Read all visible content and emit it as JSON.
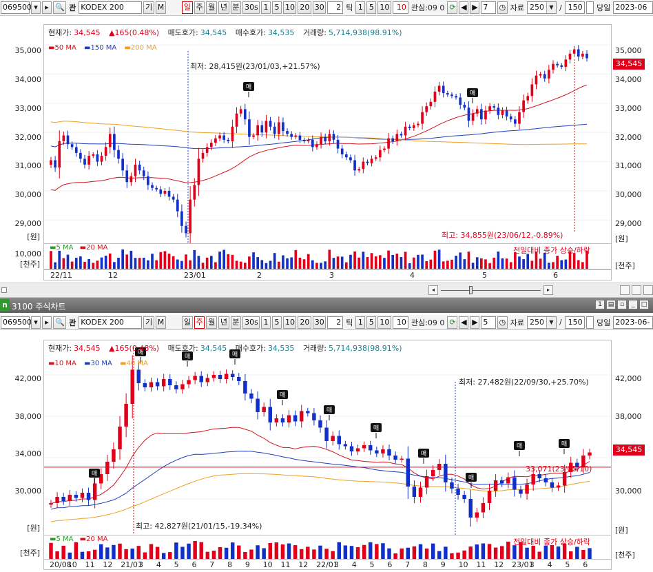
{
  "windows": [
    {
      "toolbar": {
        "code": "069500",
        "marker": "관",
        "name": "KODEX 200",
        "btn1": "기",
        "btn2": "M",
        "periods": [
          "일",
          "주",
          "월",
          "년",
          "분",
          "30s"
        ],
        "active_period": "일",
        "ticks": [
          "1",
          "5",
          "10",
          "20",
          "30"
        ],
        "tick_input": "2",
        "tick_label": "틱",
        "ticks2": [
          "1",
          "5",
          "10"
        ],
        "tick2_active": "10",
        "interest": "관심:09 0",
        "n_value": "7",
        "data_label": "자료",
        "data_count": "250",
        "slash": "/",
        "total": "150",
        "today_label": "당일",
        "date": "2023-06"
      },
      "info": {
        "cur_label": "현재가:",
        "cur": "34,545",
        "chg": "▲165(0.48%)",
        "ask_label": "매도호가:",
        "ask": "34,545",
        "bid_label": "매수호가:",
        "bid": "34,535",
        "vol_label": "거래량:",
        "vol": "5,714,938(98.91%)"
      },
      "legend": [
        {
          "label": "50 MA",
          "color": "#d4141e"
        },
        {
          "label": "150 MA",
          "color": "#1f3fbf"
        },
        {
          "label": "200 MA",
          "color": "#f0a020"
        }
      ],
      "y_ticks": [
        "35,000",
        "34,000",
        "33,000",
        "32,000",
        "31,000",
        "30,000",
        "29,000"
      ],
      "unit": "[원]",
      "last_price": "34,545",
      "low_note": "최저: 28,415원(23/01/03,+21.57%)",
      "high_note": "최고: 34,855원(23/06/12,-0.89%)",
      "sell_marks": [
        "매",
        "매"
      ],
      "vol_legend": [
        {
          "label": "5 MA",
          "color": "#2a9c2a"
        },
        {
          "label": "20 MA",
          "color": "#d4141e"
        }
      ],
      "vol_tick": "10,000",
      "vol_unit": "[천주]",
      "vol_note": "전일대비 종가 상승/하락",
      "x_labels": [
        "22/11",
        "12",
        "23/01",
        "2",
        "3",
        "4",
        "5",
        "6"
      ]
    },
    {
      "title": "3100 주식차트",
      "title_prefix": "n",
      "toolbar": {
        "code": "069500",
        "marker": "관",
        "name": "KODEX 200",
        "btn1": "기",
        "btn2": "M",
        "periods": [
          "일",
          "주",
          "월",
          "년",
          "분",
          "30s"
        ],
        "active_period": "주",
        "ticks": [
          "1",
          "5",
          "10",
          "20",
          "30"
        ],
        "tick_input": "2",
        "tick_label": "틱",
        "ticks2": [
          "1",
          "5",
          "10"
        ],
        "tick2_active": "10",
        "interest": "관심:09 0",
        "n_value": "5",
        "data_label": "자료",
        "data_count": "250",
        "slash": "/",
        "total": "150",
        "today_label": "당일",
        "date": "2023-06-"
      },
      "info": {
        "cur_label": "현재가:",
        "cur": "34,545",
        "chg": "▲165(0.48%)",
        "ask_label": "매도호가:",
        "ask": "34,545",
        "bid_label": "매수호가:",
        "bid": "34,535",
        "vol_label": "거래량:",
        "vol": "5,714,938(98.91%)"
      },
      "legend": [
        {
          "label": "10 MA",
          "color": "#d4141e"
        },
        {
          "label": "30 MA",
          "color": "#1f3fbf"
        },
        {
          "label": "40 MA",
          "color": "#f0a020"
        }
      ],
      "y_ticks": [
        "42,000",
        "38,000",
        "34,000",
        "30,000"
      ],
      "unit": "[원]",
      "last_price": "34,545",
      "low_note": "최저: 27,482원(22/09/30,+25.70%)",
      "high_note": "최고: 42,827원(21/01/15,-19.34%)",
      "hline_note": "33,071(23/05/10)",
      "sell_marks": [
        "매",
        "매",
        "매",
        "매",
        "매",
        "매",
        "매",
        "매",
        "매",
        "매",
        "매"
      ],
      "vol_legend": [
        {
          "label": "5 MA",
          "color": "#2a9c2a"
        },
        {
          "label": "20 MA",
          "color": "#d4141e"
        }
      ],
      "vol_unit": "[천주]",
      "vol_note": "전일대비 종가 상승/하락",
      "x_labels": [
        "20/08",
        "10",
        "11",
        "12",
        "21/01",
        "3",
        "4",
        "5",
        "6",
        "7",
        "8",
        "9",
        "10",
        "11",
        "12",
        "22/01",
        "3",
        "4",
        "5",
        "6",
        "7",
        "8",
        "9",
        "10",
        "11",
        "12",
        "23/01",
        "3",
        "4",
        "5",
        "6"
      ]
    }
  ],
  "chart_data": [
    {
      "type": "candlestick",
      "title": "",
      "ylim": [
        28300,
        35500
      ],
      "x_ticks": [
        "22/11",
        "12",
        "23/01",
        "2",
        "3",
        "4",
        "5",
        "6"
      ],
      "closes": [
        31050,
        30800,
        31700,
        31900,
        31600,
        31500,
        31300,
        31100,
        30900,
        31200,
        31250,
        31000,
        31200,
        31500,
        31950,
        31400,
        31100,
        30700,
        30300,
        30500,
        30900,
        30700,
        30500,
        30200,
        30100,
        30050,
        29900,
        30000,
        29800,
        29700,
        29300,
        28800,
        28550,
        29700,
        30200,
        31100,
        31300,
        31500,
        31650,
        31800,
        31900,
        31750,
        31700,
        32200,
        32650,
        32800,
        32450,
        31850,
        31900,
        32250,
        32000,
        32400,
        32200,
        31950,
        32350,
        32050,
        31950,
        31850,
        31900,
        31750,
        31700,
        31750,
        31500,
        31600,
        31850,
        31700,
        31950,
        31750,
        31450,
        31250,
        31150,
        31050,
        30700,
        30750,
        31000,
        30950,
        31100,
        31150,
        31400,
        31450,
        31800,
        31700,
        31950,
        31900,
        32200,
        32150,
        32250,
        32300,
        32700,
        32900,
        33050,
        33400,
        33600,
        33350,
        33300,
        33250,
        33200,
        32950,
        32850,
        32400,
        32650,
        32800,
        32450,
        32750,
        32900,
        32850,
        32600,
        32750,
        32550,
        32450,
        32300,
        32700,
        33100,
        33250,
        33650,
        33950,
        34000,
        33850,
        34150,
        34350,
        34300,
        34250,
        34500,
        34700,
        34850,
        34600,
        34700,
        34545
      ],
      "ma_approx": {
        "50 MA": [
          29500,
          33300
        ],
        "150 MA": [
          31700,
          31900
        ],
        "200 MA": [
          32600,
          31300
        ]
      }
    },
    {
      "type": "candlestick",
      "title": "",
      "ylim": [
        26800,
        44800
      ],
      "x_ticks": [
        "20/08",
        "10",
        "11",
        "12",
        "21/01",
        "3",
        "4",
        "5",
        "6",
        "7",
        "8",
        "9",
        "10",
        "11",
        "12",
        "22/01",
        "3",
        "4",
        "5",
        "6",
        "7",
        "8",
        "9",
        "10",
        "11",
        "12",
        "23/01",
        "3",
        "4",
        "5",
        "6"
      ],
      "closes": [
        29600,
        30200,
        29800,
        30400,
        30100,
        30600,
        29900,
        31500,
        32400,
        33600,
        34800,
        37000,
        39200,
        42500,
        41200,
        40800,
        41300,
        40900,
        41600,
        41000,
        40600,
        41100,
        41500,
        41900,
        41300,
        41700,
        42000,
        41600,
        42100,
        41800,
        41400,
        40200,
        39700,
        38400,
        38900,
        37400,
        37800,
        37400,
        38100,
        37500,
        38500,
        38300,
        37600,
        36900,
        35600,
        36100,
        35300,
        35100,
        34600,
        34900,
        35200,
        34700,
        34400,
        34800,
        34200,
        33800,
        33900,
        31200,
        30200,
        31100,
        32200,
        32800,
        33400,
        31600,
        31000,
        30400,
        30000,
        28200,
        28700,
        29600,
        30800,
        31800,
        31500,
        32100,
        30900,
        30500,
        31400,
        32400,
        32000,
        31600,
        31100,
        31300,
        32600,
        33500,
        33100,
        34200,
        34500
      ],
      "hline": 33071,
      "ma_approx": {
        "10 MA": [
          29500,
          33700
        ],
        "30 MA": [
          28600,
          32600
        ],
        "40 MA": [
          27000,
          31500
        ]
      }
    }
  ]
}
